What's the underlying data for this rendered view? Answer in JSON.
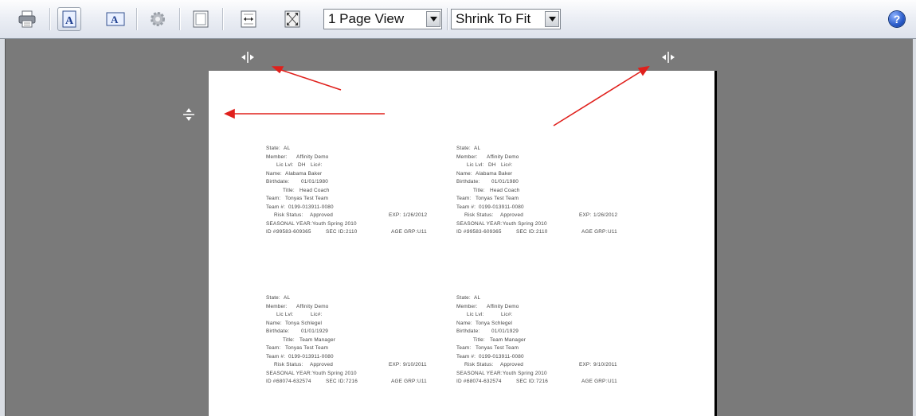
{
  "toolbar": {
    "icons": [
      "printer-icon",
      "portrait-icon",
      "landscape-icon",
      "settings-gear-icon",
      "margins-icon",
      "fit-width-icon",
      "fit-page-icon",
      "help-icon"
    ],
    "view_mode": "1 Page View",
    "scale_mode": "Shrink To Fit",
    "help_label": "?"
  },
  "colors": {
    "background": "#7a7a7a",
    "page": "#ffffff",
    "annotation_arrows": "#e0201c"
  },
  "cards": [
    {
      "state_label": "State:",
      "state": "AL",
      "member_label": "Member:",
      "member": "Affinity Demo",
      "lic_lvl_label": "Lic Lvl:",
      "lic_lvl": "DH",
      "licff_label": "Lic#:",
      "name_label": "Name:",
      "name": "Alabama Baker",
      "birthdate_label": "Birthdate:",
      "birthdate": "01/01/1980",
      "title_label": "Title:",
      "title": "Head Coach",
      "team_label": "Team:",
      "team": "Tonyas Test Team",
      "team_no_label": "Team #:",
      "team_no": "0199-013911-0080",
      "risk_label": "Risk Status:",
      "risk": "Approved",
      "exp_label": "EXP:",
      "exp": "1/26/2012",
      "season_label": "SEASONAL YEAR:",
      "season": "Youth Spring 2010",
      "id_label": "ID #:",
      "id": "99583-609365",
      "sec_label": "SEC ID:",
      "sec": "2110",
      "age_label": "AGE GRP:",
      "age": "U11"
    },
    {
      "state_label": "State:",
      "state": "AL",
      "member_label": "Member:",
      "member": "Affinity Demo",
      "lic_lvl_label": "Lic Lvl:",
      "lic_lvl": "DH",
      "licff_label": "Lic#:",
      "name_label": "Name:",
      "name": "Alabama Baker",
      "birthdate_label": "Birthdate:",
      "birthdate": "01/01/1980",
      "title_label": "Title:",
      "title": "Head Coach",
      "team_label": "Team:",
      "team": "Tonyas Test Team",
      "team_no_label": "Team #:",
      "team_no": "0199-013911-0080",
      "risk_label": "Risk Status:",
      "risk": "Approved",
      "exp_label": "EXP:",
      "exp": "1/26/2012",
      "season_label": "SEASONAL YEAR:",
      "season": "Youth Spring 2010",
      "id_label": "ID #:",
      "id": "99583-609365",
      "sec_label": "SEC ID:",
      "sec": "2110",
      "age_label": "AGE GRP:",
      "age": "U11"
    },
    {
      "state_label": "State:",
      "state": "AL",
      "member_label": "Member:",
      "member": "Affinity Demo",
      "lic_lvl_label": "Lic Lvl:",
      "lic_lvl": "",
      "licff_label": "Lic#:",
      "name_label": "Name:",
      "name": "Tonya Schlegel",
      "birthdate_label": "Birthdate:",
      "birthdate": "01/01/1929",
      "title_label": "Title:",
      "title": "Team Manager",
      "team_label": "Team:",
      "team": "Tonyas Test Team",
      "team_no_label": "Team #:",
      "team_no": "0199-013911-0080",
      "risk_label": "Risk Status:",
      "risk": "Approved",
      "exp_label": "EXP:",
      "exp": "9/10/2011",
      "season_label": "SEASONAL YEAR:",
      "season": "Youth Spring 2010",
      "id_label": "ID #:",
      "id": "68074-632574",
      "sec_label": "SEC ID:",
      "sec": "7216",
      "age_label": "AGE GRP:",
      "age": "U11"
    },
    {
      "state_label": "State:",
      "state": "AL",
      "member_label": "Member:",
      "member": "Affinity Demo",
      "lic_lvl_label": "Lic Lvl:",
      "lic_lvl": "",
      "licff_label": "Lic#:",
      "name_label": "Name:",
      "name": "Tonya Schlegel",
      "birthdate_label": "Birthdate:",
      "birthdate": "01/01/1929",
      "title_label": "Title:",
      "title": "Team Manager",
      "team_label": "Team:",
      "team": "Tonyas Test Team",
      "team_no_label": "Team #:",
      "team_no": "0199-013911-0080",
      "risk_label": "Risk Status:",
      "risk": "Approved",
      "exp_label": "EXP:",
      "exp": "9/10/2011",
      "season_label": "SEASONAL YEAR:",
      "season": "Youth Spring 2010",
      "id_label": "ID #:",
      "id": "68074-632574",
      "sec_label": "SEC ID:",
      "sec": "7216",
      "age_label": "AGE GRP:",
      "age": "U11"
    }
  ]
}
